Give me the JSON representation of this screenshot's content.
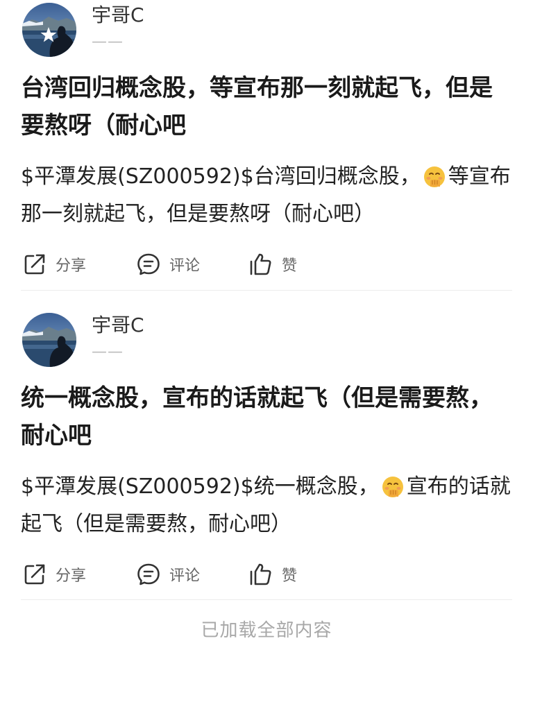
{
  "colors": {
    "text_primary": "#1a1a1a",
    "text_secondary": "#666666",
    "muted": "#a8a8a8",
    "divider": "#ececec"
  },
  "posts": [
    {
      "author": "宇哥C",
      "author_desc": "——",
      "verified": true,
      "title": "台湾回归概念股，等宣布那一刻就起飞，但是要熬呀（耐心吧",
      "content_before": "$平潭发展(SZ000592)$台湾回归概念股，",
      "emoji": "shush-emoji",
      "content_after": "等宣布那一刻就起飞，但是要熬呀（耐心吧）",
      "actions": {
        "share": "分享",
        "comment": "评论",
        "like": "赞"
      }
    },
    {
      "author": "宇哥C",
      "author_desc": "——",
      "verified": false,
      "title": "统一概念股，宣布的话就起飞（但是需要熬，耐心吧",
      "content_before": "$平潭发展(SZ000592)$统一概念股，",
      "emoji": "shush-emoji",
      "content_after": "宣布的话就起飞（但是需要熬，耐心吧）",
      "actions": {
        "share": "分享",
        "comment": "评论",
        "like": "赞"
      }
    }
  ],
  "footer": "已加载全部内容"
}
